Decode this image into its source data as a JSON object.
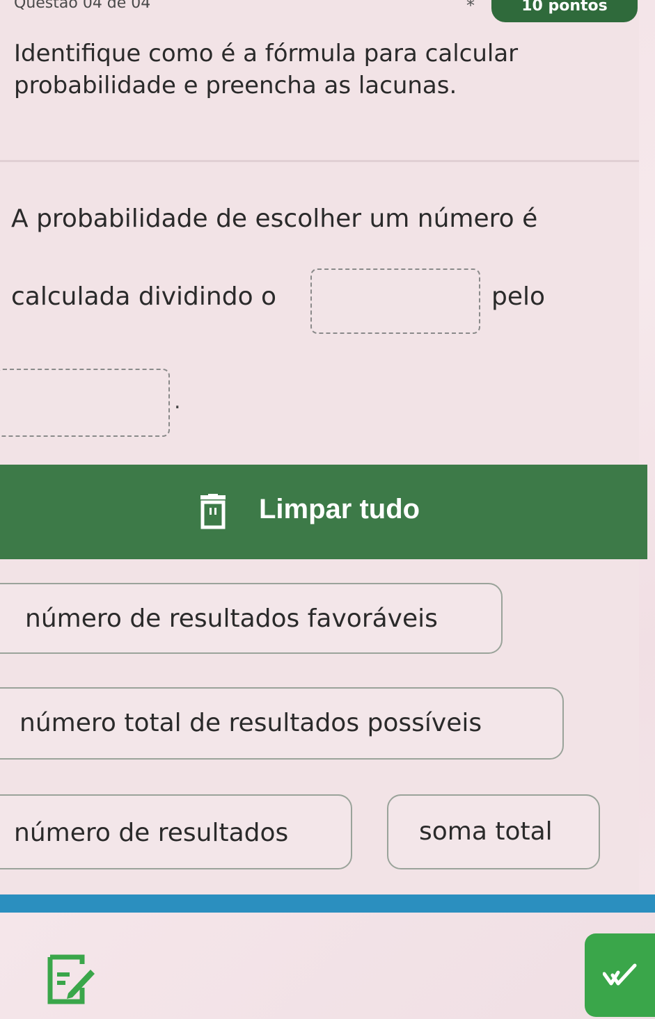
{
  "topbar": {
    "question_counter": "Questão 04 de 04",
    "required_marker": "*",
    "points": "10 pontos"
  },
  "question": {
    "prompt": "Identifique como é a fórmula para calcular probabilidade e preencha as lacunas.",
    "sentence_part1": "A probabilidade de escolher um número é",
    "sentence_part2": "calculada dividindo o",
    "sentence_part3": "pelo",
    "sentence_end": "."
  },
  "actions": {
    "clear_all_label": "Limpar tudo",
    "clear_icon": "trash-icon",
    "notes_icon": "notes-icon",
    "submit_icon": "check-icon"
  },
  "options": [
    "número de resultados favoráveis",
    "número total de resultados possíveis",
    "número de resultados",
    "soma total"
  ],
  "colors": {
    "accent_green": "#3d7a48",
    "submit_green": "#3aa64a",
    "strip_blue": "#2b8fbf",
    "badge_green": "#2f6a3b"
  }
}
